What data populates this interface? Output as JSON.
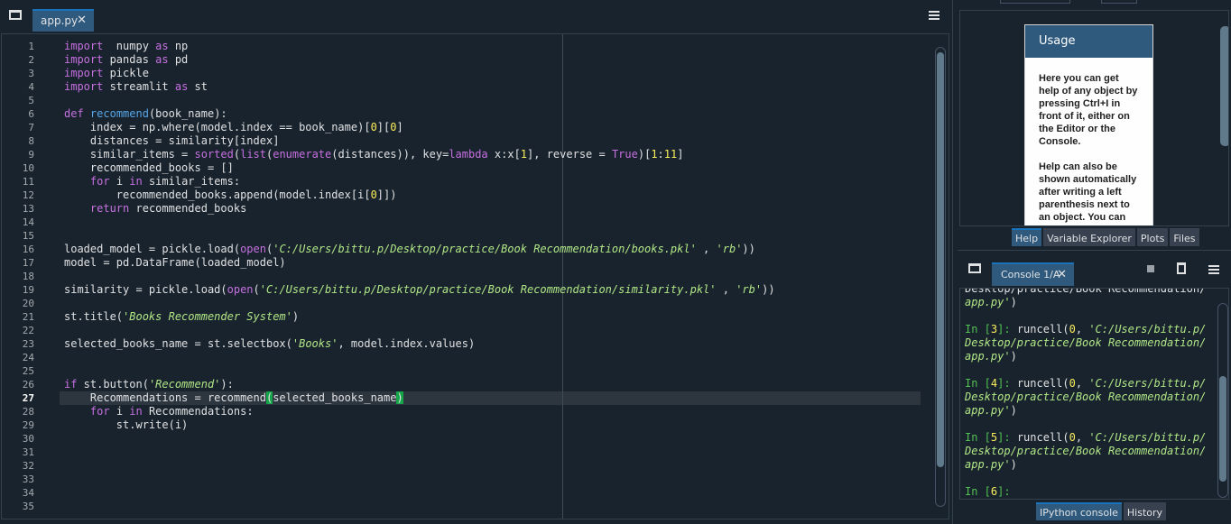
{
  "editor": {
    "tab_label": "app.py",
    "tab_close": "✕",
    "current_line": 27,
    "line_numbers": [
      "1",
      "2",
      "3",
      "4",
      "5",
      "6",
      "7",
      "8",
      "9",
      "10",
      "11",
      "12",
      "13",
      "14",
      "15",
      "16",
      "17",
      "18",
      "19",
      "20",
      "21",
      "22",
      "23",
      "24",
      "25",
      "26",
      "27",
      "28",
      "29",
      "30",
      "31",
      "32",
      "33",
      "34",
      "35"
    ],
    "code": [
      [
        [
          "kw",
          "import"
        ],
        [
          "",
          "  numpy "
        ],
        [
          "kw",
          "as"
        ],
        [
          "",
          " np"
        ]
      ],
      [
        [
          "kw",
          "import"
        ],
        [
          "",
          " pandas "
        ],
        [
          "kw",
          "as"
        ],
        [
          "",
          " pd"
        ]
      ],
      [
        [
          "kw",
          "import"
        ],
        [
          "",
          " pickle"
        ]
      ],
      [
        [
          "kw",
          "import"
        ],
        [
          "",
          " streamlit "
        ],
        [
          "kw",
          "as"
        ],
        [
          "",
          " st"
        ]
      ],
      [],
      [
        [
          "kw",
          "def"
        ],
        [
          "",
          " "
        ],
        [
          "def-name",
          "recommend"
        ],
        [
          "",
          "(book_name):"
        ]
      ],
      [
        [
          "",
          "    index = np.where(model.index == book_name)["
        ],
        [
          "num",
          "0"
        ],
        [
          "",
          "]["
        ],
        [
          "num",
          "0"
        ],
        [
          "",
          "]"
        ]
      ],
      [
        [
          "",
          "    distances = similarity[index]"
        ]
      ],
      [
        [
          "",
          "    similar_items = "
        ],
        [
          "builtin",
          "sorted"
        ],
        [
          "",
          "("
        ],
        [
          "builtin",
          "list"
        ],
        [
          "",
          "("
        ],
        [
          "builtin",
          "enumerate"
        ],
        [
          "",
          "(distances)), key="
        ],
        [
          "kw",
          "lambda"
        ],
        [
          "",
          " x:x["
        ],
        [
          "num",
          "1"
        ],
        [
          "",
          "], reverse = "
        ],
        [
          "kw",
          "True"
        ],
        [
          "",
          ")["
        ],
        [
          "num",
          "1"
        ],
        [
          "",
          ":"
        ],
        [
          "num",
          "11"
        ],
        [
          "",
          "]"
        ]
      ],
      [
        [
          "",
          "    recommended_books = []"
        ]
      ],
      [
        [
          "",
          "    "
        ],
        [
          "kw",
          "for"
        ],
        [
          "",
          " i "
        ],
        [
          "kw",
          "in"
        ],
        [
          "",
          " similar_items:"
        ]
      ],
      [
        [
          "",
          "        recommended_books.append(model.index[i["
        ],
        [
          "num",
          "0"
        ],
        [
          "",
          "]])"
        ]
      ],
      [
        [
          "",
          "    "
        ],
        [
          "kw",
          "return"
        ],
        [
          "",
          " recommended_books"
        ]
      ],
      [],
      [],
      [
        [
          "",
          "loaded_model = pickle.load("
        ],
        [
          "builtin",
          "open"
        ],
        [
          "",
          "("
        ],
        [
          "str",
          "'C:/Users/bittu.p/Desktop/practice/Book Recommendation/books.pkl'"
        ],
        [
          "",
          " , "
        ],
        [
          "str",
          "'rb'"
        ],
        [
          "",
          "))"
        ]
      ],
      [
        [
          "",
          "model = pd.DataFrame(loaded_model)"
        ]
      ],
      [],
      [
        [
          "",
          "similarity = pickle.load("
        ],
        [
          "builtin",
          "open"
        ],
        [
          "",
          "("
        ],
        [
          "str",
          "'C:/Users/bittu.p/Desktop/practice/Book Recommendation/similarity.pkl'"
        ],
        [
          "",
          " , "
        ],
        [
          "str",
          "'rb'"
        ],
        [
          "",
          "))"
        ]
      ],
      [],
      [
        [
          "",
          "st.title("
        ],
        [
          "str",
          "'Books Recommender System'"
        ],
        [
          "",
          ")"
        ]
      ],
      [],
      [
        [
          "",
          "selected_books_name = st.selectbox("
        ],
        [
          "str",
          "'Books'"
        ],
        [
          "",
          ", model.index.values)"
        ]
      ],
      [],
      [],
      [
        [
          "kw",
          "if"
        ],
        [
          "",
          " st.button("
        ],
        [
          "str",
          "'Recommend'"
        ],
        [
          "",
          "):"
        ]
      ],
      [
        [
          "",
          "    Recommendations = recommend"
        ],
        [
          "bracket-match",
          "("
        ],
        [
          "",
          "selected_books_name"
        ],
        [
          "bracket-match",
          ")"
        ]
      ],
      [
        [
          "",
          "    "
        ],
        [
          "kw",
          "for"
        ],
        [
          "",
          " i "
        ],
        [
          "kw",
          "in"
        ],
        [
          "",
          " Recommendations:"
        ]
      ],
      [
        [
          "",
          "        st.write(i)"
        ]
      ],
      [],
      [],
      [],
      [],
      [],
      []
    ]
  },
  "help": {
    "title": "Usage",
    "paragraph1_a": "Here you can get help of any object by pressing ",
    "paragraph1_key": "Ctrl+I",
    "paragraph1_b": " in front of it, either on the Editor or the Console.",
    "paragraph2": "Help can also be shown automatically after writing a left parenthesis next to an object. You can activate this",
    "tabs": [
      "Help",
      "Variable Explorer",
      "Plots",
      "Files"
    ],
    "active_tab": "Help"
  },
  "console": {
    "tab_label": "Console 1/A",
    "tab_close": "✕",
    "lines": [
      [
        [
          "",
          "Desktop/practice/Book Recommendation/"
        ]
      ],
      [
        [
          "cstr",
          "app.py'"
        ],
        [
          "",
          ")"
        ]
      ],
      [],
      [
        [
          "prompt",
          "In ["
        ],
        [
          "cnum",
          "3"
        ],
        [
          "prompt",
          "]: "
        ],
        [
          "",
          "runcell("
        ],
        [
          "cnum",
          "0"
        ],
        [
          "",
          ", "
        ],
        [
          "cstr",
          "'C:/Users/bittu.p/"
        ]
      ],
      [
        [
          "cstr",
          "Desktop/practice/Book Recommendation/"
        ]
      ],
      [
        [
          "cstr",
          "app.py'"
        ],
        [
          "",
          ")"
        ]
      ],
      [],
      [
        [
          "prompt",
          "In ["
        ],
        [
          "cnum",
          "4"
        ],
        [
          "prompt",
          "]: "
        ],
        [
          "",
          "runcell("
        ],
        [
          "cnum",
          "0"
        ],
        [
          "",
          ", "
        ],
        [
          "cstr",
          "'C:/Users/bittu.p/"
        ]
      ],
      [
        [
          "cstr",
          "Desktop/practice/Book Recommendation/"
        ]
      ],
      [
        [
          "cstr",
          "app.py'"
        ],
        [
          "",
          ")"
        ]
      ],
      [],
      [
        [
          "prompt",
          "In ["
        ],
        [
          "cnum",
          "5"
        ],
        [
          "prompt",
          "]: "
        ],
        [
          "",
          "runcell("
        ],
        [
          "cnum",
          "0"
        ],
        [
          "",
          ", "
        ],
        [
          "cstr",
          "'C:/Users/bittu.p/"
        ]
      ],
      [
        [
          "cstr",
          "Desktop/practice/Book Recommendation/"
        ]
      ],
      [
        [
          "cstr",
          "app.py'"
        ],
        [
          "",
          ")"
        ]
      ],
      [],
      [
        [
          "prompt",
          "In ["
        ],
        [
          "cnum",
          "6"
        ],
        [
          "prompt",
          "]:"
        ]
      ]
    ],
    "tabs": [
      "IPython console",
      "History"
    ],
    "active_tab": "IPython console"
  },
  "colors": {
    "background": "#19232d",
    "accent": "#1a72bb",
    "tab_active": "#2f5a7d",
    "keyword": "#c670e0",
    "string": "#b0e686",
    "number": "#faed5c",
    "prompt": "#51c151"
  },
  "icons": [
    "undock-icon",
    "close-icon",
    "options-menu-icon",
    "stop-icon",
    "trash-icon"
  ]
}
